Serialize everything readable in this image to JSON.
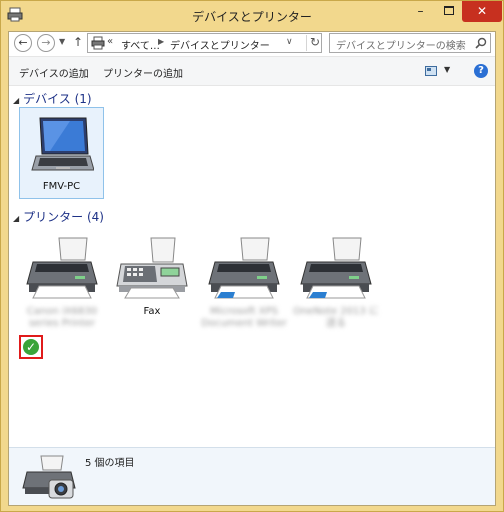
{
  "window": {
    "title": "デバイスとプリンター"
  },
  "navigation": {
    "back": "←",
    "forward": "→",
    "up": "↑",
    "breadcrumb": [
      "すべて…",
      "デバイスとプリンター"
    ],
    "breadcrumb_prefix": "«",
    "search_placeholder": "デバイスとプリンターの検索"
  },
  "commandbar": {
    "items": [
      "デバイスの追加",
      "プリンターの追加"
    ]
  },
  "groups": {
    "devices": {
      "label": "デバイス (1)"
    },
    "printers": {
      "label": "プリンター (4)"
    }
  },
  "devices": [
    {
      "name": "FMV-PC",
      "icon": "laptop-icon",
      "selected": true
    }
  ],
  "printers": [
    {
      "name": "Canon iX6830 series Printer",
      "icon": "printer-icon",
      "default": true,
      "blurred": true
    },
    {
      "name": "Fax",
      "icon": "fax-icon",
      "default": false,
      "blurred": false
    },
    {
      "name": "Microsoft XPS Document Writer",
      "icon": "printer-icon",
      "default": false,
      "blurred": true
    },
    {
      "name": "OneNote 2013 に送る",
      "icon": "printer-icon",
      "default": false,
      "blurred": true
    }
  ],
  "details": {
    "summary": "5 個の項目"
  },
  "colors": {
    "frame": "#f2d88d",
    "close": "#c7301f",
    "group_heading": "#1e3287",
    "selection": "#e8f2fc",
    "default_mark": "#3aa43a",
    "highlight_box": "#e01b1b"
  }
}
